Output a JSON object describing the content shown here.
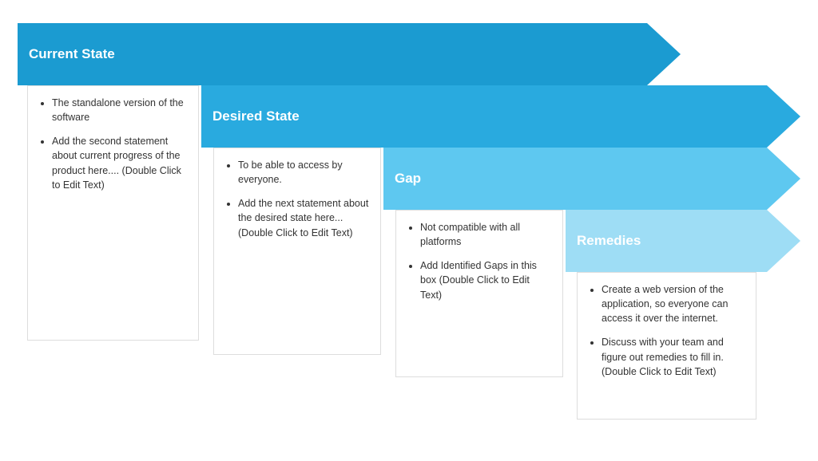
{
  "arrows": [
    {
      "id": "arrow-1",
      "title": "Current State",
      "color": "#1b9bd1"
    },
    {
      "id": "arrow-2",
      "title": "Desired State",
      "color": "#29aadf"
    },
    {
      "id": "arrow-3",
      "title": "Gap",
      "color": "#5ec8f0"
    },
    {
      "id": "arrow-4",
      "title": "Remedies",
      "color": "#9eddf5"
    }
  ],
  "cards": {
    "current_state": {
      "items": [
        "The standalone version of the software",
        "Add the second statement about current progress of the product here.... (Double Click to Edit Text)"
      ]
    },
    "desired_state": {
      "items": [
        "To be able to access by everyone.",
        "Add the next statement about the desired state here...    (Double Click to Edit Text)"
      ]
    },
    "gap": {
      "items": [
        "Not compatible with all platforms",
        "Add Identified Gaps in this box (Double Click to Edit Text)"
      ]
    },
    "remedies": {
      "items": [
        "Create a web version of the application, so everyone  can access it over the internet.",
        "Discuss with your team and figure out  remedies to fill in. (Double Click to Edit Text)"
      ]
    }
  }
}
